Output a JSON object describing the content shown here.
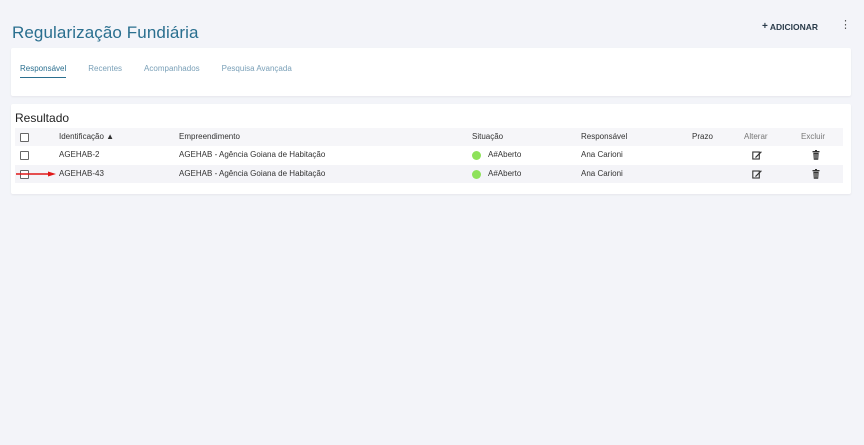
{
  "header": {
    "title": "Regularização Fundiária",
    "add_label": "ADICIONAR",
    "add_icon": "+",
    "more_icon": "⋮"
  },
  "tabs": [
    {
      "label": "Responsável",
      "active": true
    },
    {
      "label": "Recentes",
      "active": false
    },
    {
      "label": "Acompanhados",
      "active": false
    },
    {
      "label": "Pesquisa Avançada",
      "active": false
    }
  ],
  "result": {
    "title": "Resultado",
    "columns": {
      "identificacao": "Identificação ▲",
      "empreendimento": "Empreendimento",
      "situacao": "Situação",
      "responsavel": "Responsável",
      "prazo": "Prazo",
      "alterar": "Alterar",
      "excluir": "Excluir"
    },
    "rows": [
      {
        "identificacao": "AGEHAB-2",
        "empreendimento": "AGEHAB - Agência Goiana de Habitação",
        "situacao": "A#Aberto",
        "responsavel": "Ana Carioni",
        "prazo": ""
      },
      {
        "identificacao": "AGEHAB-43",
        "empreendimento": "AGEHAB - Agência Goiana de Habitação",
        "situacao": "A#Aberto",
        "responsavel": "Ana Carioni",
        "prazo": ""
      }
    ]
  },
  "colors": {
    "title": "#2a6f8f",
    "status_open": "#8ee25a",
    "arrow": "#e01818"
  }
}
